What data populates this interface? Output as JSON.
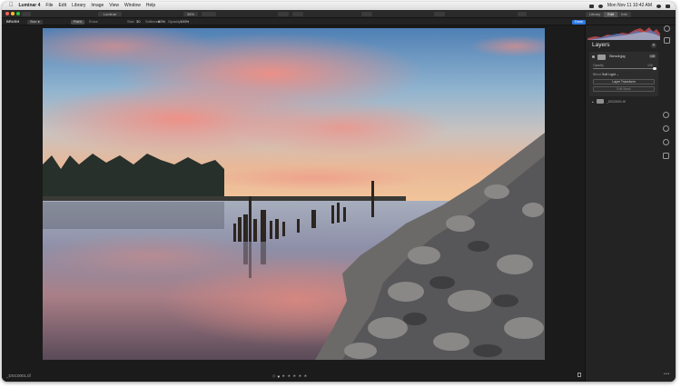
{
  "menubar": {
    "app_name": "Luminar 4",
    "items": [
      "File",
      "Edit",
      "Library",
      "Image",
      "View",
      "Window",
      "Help"
    ],
    "clock": "Mon Nov 11 10:42 AM"
  },
  "toolbar": {
    "left_button": "Luminar",
    "zoom": "36%",
    "right_tabs": [
      "Library",
      "Edit",
      "Info"
    ],
    "active_right_tab": "Edit"
  },
  "inforow": {
    "label": "BRUSH",
    "field_a": "Size  ●",
    "paint_label": "Paint",
    "erase_label": "Erase",
    "size_label": "Size",
    "size_value": "30",
    "softness_label": "Softness",
    "softness_value": "80%",
    "opacity_label": "Opacity",
    "opacity_value": "100%",
    "done_label": "Done"
  },
  "bottom": {
    "filename": "_DSC0001.tif",
    "stars": [
      "★",
      "★",
      "★",
      "★",
      "★"
    ],
    "heart": "♥",
    "flag": "◇"
  },
  "panel": {
    "title": "Layers",
    "add_symbol": "+",
    "layer": {
      "name": "Stencil.jpg",
      "badge": "100",
      "opacity_label": "Opacity",
      "opacity_value": "100",
      "opacity_fraction": 1.0,
      "blend_label": "Blend",
      "blend_value": "Soft Light ⌄",
      "transform_button": "Layer Transform",
      "edit_mask_button": "Edit Mask"
    },
    "base_layer": "_DSC0001.tif"
  },
  "colors": {
    "accent": "#2c7be5",
    "panel_bg": "#232323",
    "canvas_bg": "#1b1b1b"
  },
  "icons": [
    "apple-icon",
    "search-icon",
    "histogram-icon",
    "eye-icon",
    "trash-icon",
    "canvas-icon",
    "portrait-icon",
    "professional-icon",
    "presets-icon"
  ]
}
